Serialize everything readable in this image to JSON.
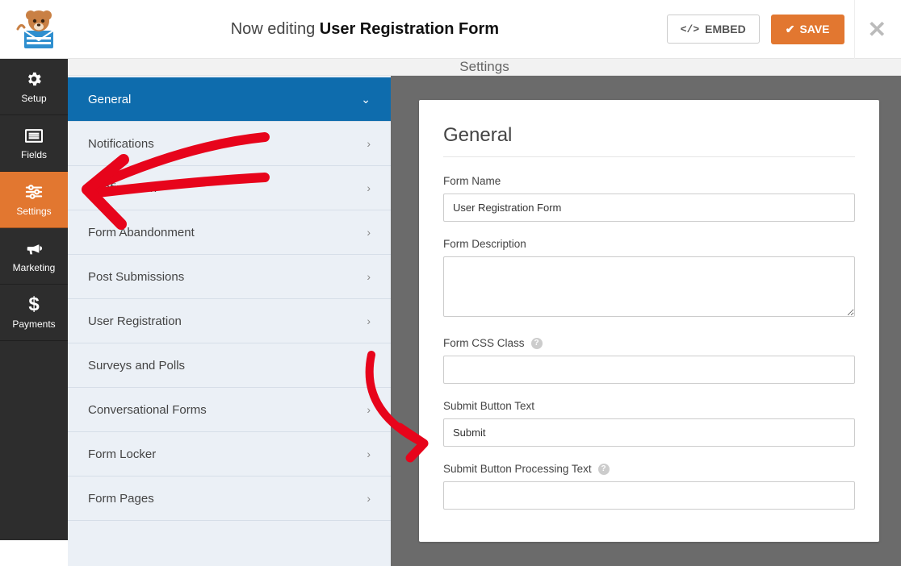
{
  "header": {
    "editing_prefix": "Now editing",
    "form_title": "User Registration Form",
    "embed_label": "EMBED",
    "save_label": "SAVE"
  },
  "rail": {
    "items": [
      {
        "label": "Setup",
        "icon": "gear"
      },
      {
        "label": "Fields",
        "icon": "list"
      },
      {
        "label": "Settings",
        "icon": "sliders",
        "active": true
      },
      {
        "label": "Marketing",
        "icon": "bullhorn"
      },
      {
        "label": "Payments",
        "icon": "dollar"
      }
    ]
  },
  "panel": {
    "header": "Settings",
    "items": [
      {
        "label": "General",
        "active": true,
        "expand": "down"
      },
      {
        "label": "Notifications",
        "expand": "right"
      },
      {
        "label": "Confirmation",
        "expand": "right"
      },
      {
        "label": "Form Abandonment",
        "expand": "right"
      },
      {
        "label": "Post Submissions",
        "expand": "right"
      },
      {
        "label": "User Registration",
        "expand": "right"
      },
      {
        "label": "Surveys and Polls",
        "expand": "none"
      },
      {
        "label": "Conversational Forms",
        "expand": "right"
      },
      {
        "label": "Form Locker",
        "expand": "right"
      },
      {
        "label": "Form Pages",
        "expand": "right"
      }
    ]
  },
  "general": {
    "heading": "General",
    "form_name_label": "Form Name",
    "form_name_value": "User Registration Form",
    "form_description_label": "Form Description",
    "form_description_value": "",
    "form_css_class_label": "Form CSS Class",
    "form_css_class_value": "",
    "submit_button_text_label": "Submit Button Text",
    "submit_button_text_value": "Submit",
    "submit_button_processing_label": "Submit Button Processing Text",
    "submit_button_processing_value": ""
  },
  "colors": {
    "accent": "#e27730",
    "panel_active": "#0e6cad",
    "annotation": "#e7041b"
  }
}
